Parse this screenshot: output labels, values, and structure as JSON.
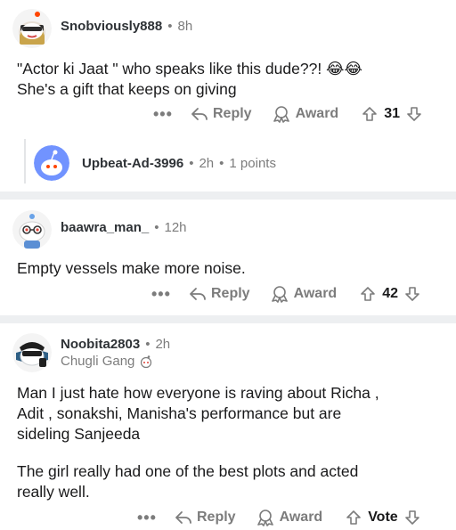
{
  "comments": [
    {
      "username": "Snobviously888",
      "time": "8h",
      "body": [
        "\"Actor ki Jaat \" who speaks like this dude??! 😂😂",
        "She's a gift that keeps on giving"
      ],
      "actions": {
        "more": "•••",
        "reply": "Reply",
        "award": "Award",
        "votes": "31"
      }
    },
    {
      "username": "Upbeat-Ad-3996",
      "time": "2h",
      "points": "1 points"
    },
    {
      "username": "baawra_man_",
      "time": "12h",
      "body": [
        "Empty vessels make more noise."
      ],
      "actions": {
        "more": "•••",
        "reply": "Reply",
        "award": "Award",
        "votes": "42"
      }
    },
    {
      "username": "Noobita2803",
      "time": "2h",
      "flair": "Chugli Gang",
      "body": [
        "Man I just hate how everyone is raving about  Richa ,",
        "Adit , sonakshi, Manisha's performance but are",
        "sideling Sanjeeda"
      ],
      "body2": [
        "The girl really had one of the best plots and acted",
        "really well."
      ],
      "actions": {
        "more": "•••",
        "reply": "Reply",
        "award": "Award",
        "votes": "Vote"
      }
    }
  ],
  "separator": "•",
  "colors": {
    "divider": "#edeff1",
    "meta_gray": "#7c7c7c",
    "text": "#1a1a1b",
    "upvote_blue": "#6f93c8"
  }
}
